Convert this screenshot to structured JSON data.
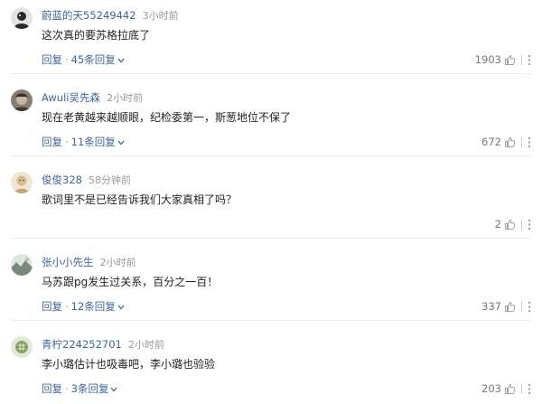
{
  "comments": [
    {
      "username": "蔚蓝的天55249442",
      "time": "3小时前",
      "text": "这次真的要苏格拉底了",
      "reply_label": "回复",
      "replies_label": "45条回复",
      "likes": "1903",
      "avatar_color": "#2a2a2a"
    },
    {
      "username": "Awuli吴先森",
      "time": "2小时前",
      "text": "现在老黄越来越顺眼，纪检委第一，斯葱地位不保了",
      "reply_label": "回复",
      "replies_label": "11条回复",
      "likes": "672",
      "avatar_color": "#5a5046"
    },
    {
      "username": "俊俊328",
      "time": "58分钟前",
      "text": "歌词里不是已经告诉我们大家真相了吗？",
      "reply_label": "回复",
      "replies_label": "",
      "likes": "2",
      "avatar_color": "#c9a36f"
    },
    {
      "username": "张小小先生",
      "time": "2小时前",
      "text": "马苏跟pg发生过关系，百分之一百！",
      "reply_label": "回复",
      "replies_label": "12条回复",
      "likes": "337",
      "avatar_color": "#7a8a7a"
    },
    {
      "username": "青柠224252701",
      "time": "2小时前",
      "text": "李小璐估计也吸毒吧，李小璐也验验",
      "reply_label": "回复",
      "replies_label": "3条回复",
      "likes": "203",
      "avatar_color": "#6f8a5a"
    }
  ],
  "colors": {
    "link": "#406599",
    "meta": "#999999",
    "body_text": "#222222",
    "divider": "#ebebeb"
  },
  "icons": {
    "like": "thumbs-up-icon",
    "more": "more-options-icon",
    "expand": "chevron-down-icon"
  }
}
